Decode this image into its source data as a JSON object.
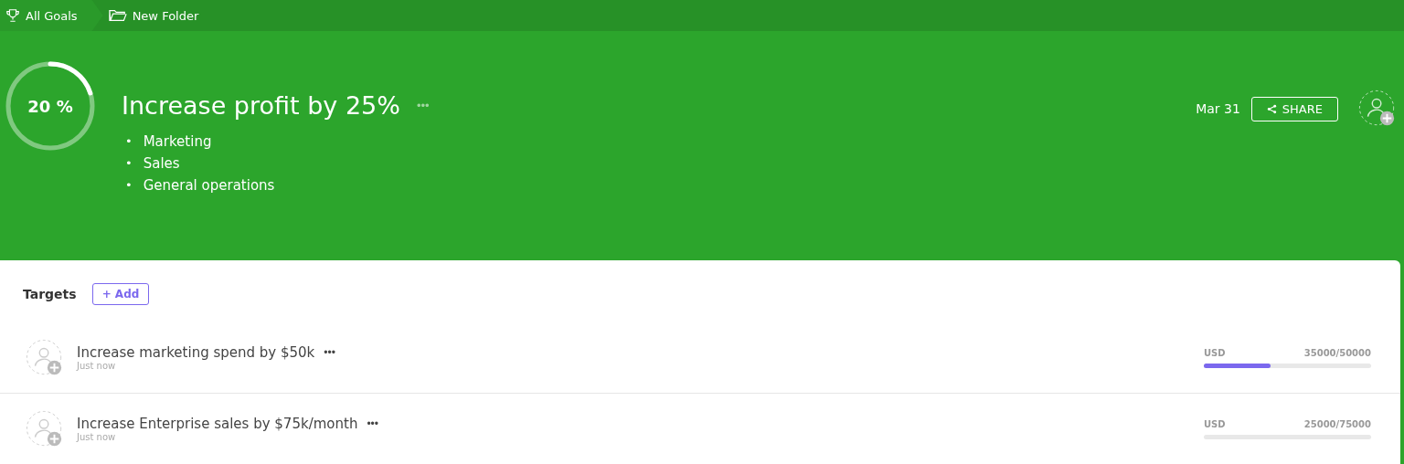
{
  "breadcrumbs": [
    {
      "label": "All Goals",
      "kind": "goals"
    },
    {
      "label": "New Folder",
      "kind": "folder"
    }
  ],
  "goal": {
    "progress": {
      "label": "20 %",
      "level": 0.2
    },
    "title": "Increase profit by 25%",
    "more": "•••",
    "bullets": [
      {
        "marker": "•",
        "label": "Marketing"
      },
      {
        "marker": "•",
        "label": "Sales"
      },
      {
        "marker": "•",
        "label": "General operations"
      }
    ],
    "due": "Mar 31",
    "share": "SHARE"
  },
  "targets": {
    "heading": "Targets",
    "add": "+ Add",
    "rows": [
      {
        "title": "Increase marketing spend by $50k",
        "more": "•••",
        "time": "Just now",
        "unit": "USD",
        "reading": "35000/50000",
        "level": 0.4
      },
      {
        "title": "Increase Enterprise sales by $75k/month",
        "more": "•••",
        "time": "Just now",
        "unit": "USD",
        "reading": "25000/75000"
      }
    ]
  }
}
